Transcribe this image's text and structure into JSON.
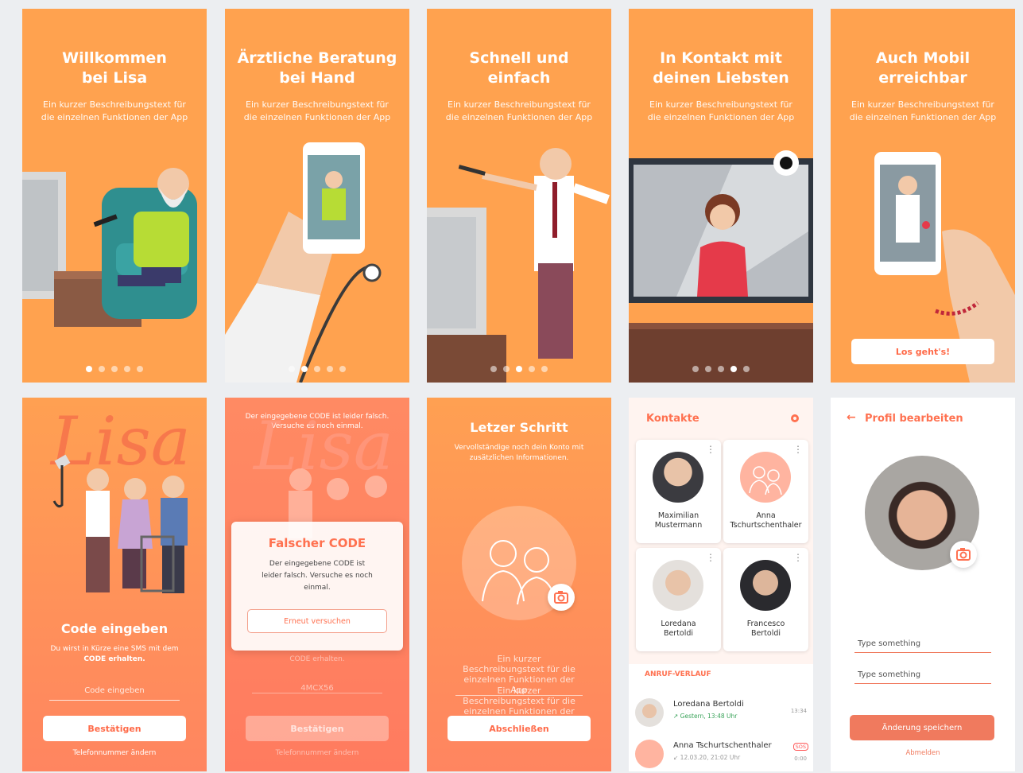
{
  "colors": {
    "orange": "#ffa24f",
    "coral": "#ff7a5c",
    "white": "#ffffff",
    "accent": "#f07a5e"
  },
  "onboarding": [
    {
      "title_l1": "Willkommen",
      "title_l2": "bei Lisa",
      "desc_l1": "Ein kurzer Beschreibungstext für",
      "desc_l2": "die einzelnen Funktionen der App",
      "active_dot": 1
    },
    {
      "title_l1": "Ärztliche Beratung",
      "title_l2": "bei Hand",
      "desc_l1": "Ein kurzer Beschreibungstext für",
      "desc_l2": "die einzelnen Funktionen der App",
      "active_dot": 2
    },
    {
      "title_l1": "Schnell und",
      "title_l2": "einfach",
      "desc_l1": "Ein kurzer Beschreibungstext für",
      "desc_l2": "die einzelnen Funktionen der App",
      "active_dot": 3
    },
    {
      "title_l1": "In Kontakt mit",
      "title_l2": "deinen Liebsten",
      "desc_l1": "Ein kurzer Beschreibungstext für",
      "desc_l2": "die einzelnen Funktionen der App",
      "active_dot": 4
    },
    {
      "title_l1": "Auch Mobil",
      "title_l2": "erreichbar",
      "desc_l1": "Ein kurzer Beschreibungstext für",
      "desc_l2": "die einzelnen Funktionen der App",
      "button": "Los geht's!"
    }
  ],
  "code": {
    "logo": "Lisa",
    "title": "Code eingeben",
    "hint_l1": "Du wirst in Kürze eine SMS mit dem",
    "hint_l2": "CODE erhalten.",
    "placeholder": "Code eingeben",
    "confirm": "Bestätigen",
    "change_phone": "Telefonnummer ändern"
  },
  "code_error": {
    "banner_l1": "Der eingegebene CODE ist leider falsch.",
    "banner_l2": "Versuche es noch einmal.",
    "modal_title": "Falscher CODE",
    "modal_l1": "Der eingegebene CODE ist",
    "modal_l2": "leider falsch. Versuche es noch",
    "modal_l3": "einmal.",
    "retry": "Erneut versuchen",
    "bg_hint": "CODE erhalten.",
    "value": "4MCX56",
    "confirm": "Bestätigen",
    "change_phone": "Telefonnummer ändern"
  },
  "last_step": {
    "title": "Letzer Schritt",
    "desc_l1": "Vervollständige noch dein Konto mit",
    "desc_l2": "zusätzlichen Informationen.",
    "field1": "Ein kurzer Beschreibungstext für die einzelnen Funktionen der App",
    "field2": "Ein kurzer Beschreibungstext für die einzelnen Funktionen der App",
    "button": "Abschließen"
  },
  "contacts": {
    "title": "Kontakte",
    "people": [
      {
        "first": "Maximilian",
        "last": "Mustermann"
      },
      {
        "first": "Anna",
        "last": "Tschurtschenthaler"
      },
      {
        "first": "Loredana",
        "last": "Bertoldi"
      },
      {
        "first": "Francesco",
        "last": "Bertoldi"
      }
    ],
    "history_label": "ANRUF-VERLAUF",
    "calls": [
      {
        "name": "Loredana Bertoldi",
        "meta": "↗ Gestern, 13:48 Uhr",
        "time": "13:34"
      },
      {
        "name": "Anna Tschurtschenthaler",
        "meta": "↙ 12.03.20, 21:02 Uhr",
        "time": "0:00",
        "badge": "SOS"
      }
    ]
  },
  "profile": {
    "title": "Profil bearbeiten",
    "input1": "Type something",
    "input2": "Type something",
    "save": "Änderung speichern",
    "logout": "Abmelden"
  }
}
